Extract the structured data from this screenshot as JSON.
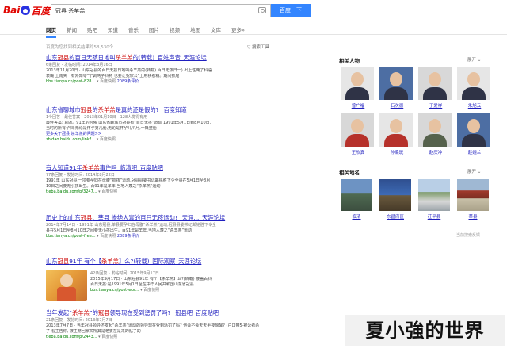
{
  "header": {
    "logo": {
      "left": "Bai",
      "right": "百度"
    },
    "query": "冠县 杀羊羔",
    "search_button": "百度一下"
  },
  "tabs": [
    "网页",
    "新闻",
    "贴吧",
    "知道",
    "音乐",
    "图片",
    "视频",
    "地图",
    "文库",
    "更多»"
  ],
  "result_count": "百度为您找到相关结果约58,530个",
  "tools": "搜索工具",
  "results": [
    {
      "title_pre": "山东",
      "title_kw": "冠县",
      "title_mid": "的百日无孩日地叫",
      "title_kw2": "杀羊羔",
      "title_post": "的(转载)_百姓声音_天涯论坛",
      "meta": "6条回复 - 发帖时间: 2014年3月16日",
      "snippet1": "2013年11月20日 · 山东冠县的百日无孩日地叫杀羊羔的(转载) 百日无孩日一) 出上性两了科语",
      "snippet2": "表糊 上南失一有外知零“宁调两子科特 也要让冤家公”上用税者精。期间抓尾",
      "url": "bbs.tianya.cn/post-828...",
      "snapshot": "百度快照",
      "extra": "2089条评价"
    },
    {
      "title_pre": "山东省聊城市",
      "title_kw": "冠县",
      "title_mid": "的",
      "title_kw2": "杀羊羔",
      "title_post": "是真的还是假的? _百度知道",
      "meta": "1个回答 - 最佳答案 - 2013年01月10日 - 128人觉得有用",
      "snippet1": "最佳答案: 真的。91年的时候 山东省聊城市冠县有“百日无孩”运动 1991年5月1日到8月10日,",
      "snippet2": "当时的所有孕妇,无论是怀孕第几胎,无论是怀孕几个月,一概堕胎",
      "sub": "更多关于冠县 杀羊羔的问题>>",
      "url": "zhidao.baidu.com/link?...",
      "snapshot": "百度快照"
    },
    {
      "title_pre": "有人知道91年",
      "title_kw": "杀羊羔",
      "title_mid": "事件吗_临清吧_百度贴吧",
      "title_kw2": "",
      "title_post": "",
      "meta": "77条回复 - 发帖时间: 2014年8月22日",
      "snippet1": "1991年 山东冠县,一项要孕妇在母腹“抓孩”运动,冠县县委书记邮铭胜下令全县在5月1日至8月",
      "snippet2": "10日之间要无小孩出生。百91年是羊年,当地人蔑之“杀羊羔”运动",
      "url": "tieba.baidu.com/p/3247...",
      "snapshot": "百度快照"
    },
    {
      "title_pre": "历史上的山东",
      "title_kw": "冠县",
      "title_mid": "、莘县 惨绝人寰的百日无孩运动! _天涯..._天涯论坛",
      "title_kw2": "",
      "title_post": "",
      "meta": "2014年7月14日 · 1991年 山东冠县,莘县要孕妇在母腹“杀羊羔”运动,冠县县委书记邮铭胜下令全",
      "snippet1": "县在5月1日至8月10日之间要无小孩出生。百91年是羊年,当地人蔑之“杀羊羔”运动",
      "snippet2": "",
      "url": "bbs.tianya.cn/post-free...",
      "snapshot": "百度快照",
      "extra": "2089条评价"
    },
    {
      "title_pre": "山东",
      "title_kw": "冠县",
      "title_mid": "91年 有个【",
      "title_kw2": "杀羊羔",
      "title_post": "】么?(转载)_国际观察_天涯论坛",
      "meta": "42条回复 - 发帖时间: 2015年9月17日",
      "snippet1": "2015年9月17日 · 山东冠县91年 有个【杀羊羔】么?(转载) 楼盖百科",
      "snippet2": "百日无孩:是1991年5月1日至在中华人民共和国山东省冠县",
      "url": "bbs.tianya.cn/post-wor...",
      "snapshot": "百度快照"
    },
    {
      "title_pre": "当年发起“",
      "title_kw": "杀羊羔",
      "title_mid": "”的",
      "title_kw2": "冠县",
      "title_post": "领导现在受到惩罚了吗? _冠县吧_百度贴吧",
      "meta": "21条回复 - 发帖时间: 2013年7月7日",
      "snippet1": "2013年7月7日 · 当年冠县领导还发起“杀羊羔”运动的领导现在受到惩罚了吗? 他会不会天天半夜惊醒? (户口带5·被公者杀",
      "snippet2": "了 看主告你, 被主席回家买所其是老婆在是来的贴子的",
      "url": "tieba.baidu.com/p/2443...",
      "snapshot": "百度快照"
    }
  ],
  "panel": {
    "people_title": "相关人物",
    "people_expand": "展开 ⌄",
    "people": [
      {
        "name": "曾广福"
      },
      {
        "name": "石次德"
      },
      {
        "name": "于爱祥"
      },
      {
        "name": "朱旭云"
      },
      {
        "name": "王欣真"
      },
      {
        "name": "孙柔玩"
      },
      {
        "name": "赵庆冲"
      },
      {
        "name": "赵婉兰"
      }
    ],
    "places_title": "相关地名",
    "places_expand": "展开 ⌄",
    "places": [
      {
        "name": "临清"
      },
      {
        "name": "东昌府区"
      },
      {
        "name": "茌平县"
      },
      {
        "name": "莘县"
      }
    ],
    "feedback": "当前搜索反馈"
  },
  "watermark": "夏小強的世界"
}
